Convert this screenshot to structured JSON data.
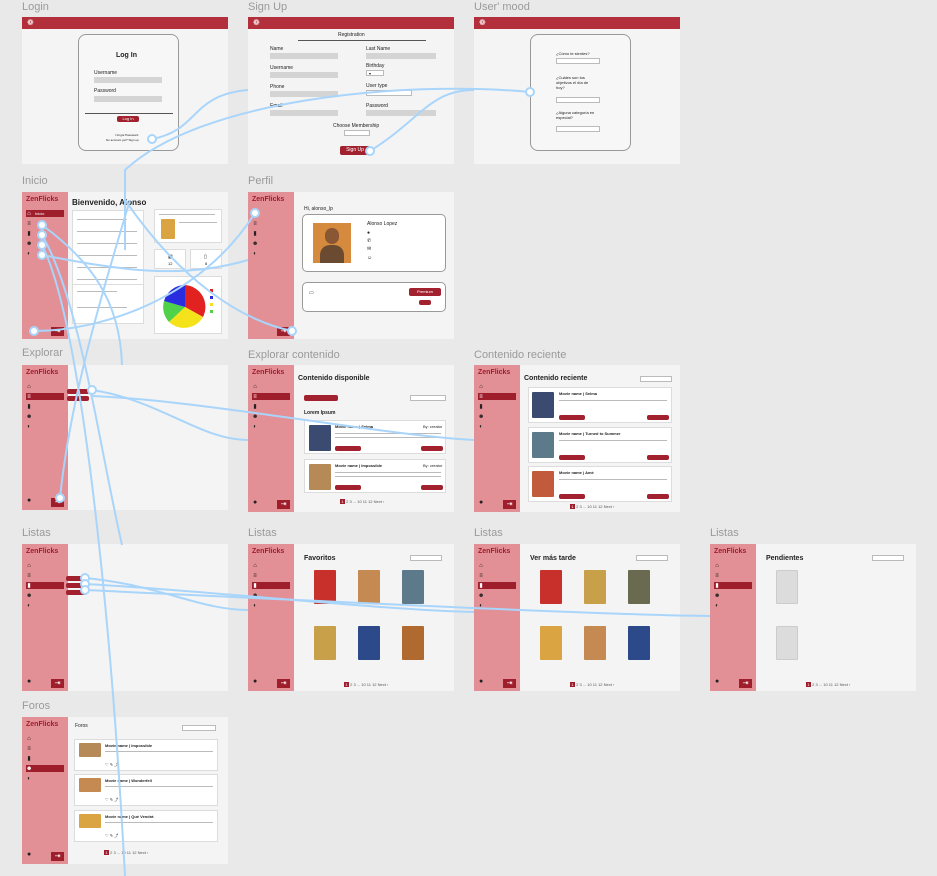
{
  "colors": {
    "accent": "#a1212f",
    "sidebar": "#e38f96",
    "topbar": "#b32f3b",
    "wire": "#a9d5fb"
  },
  "frames": {
    "login": "Login",
    "signup": "Sign Up",
    "mood": "User' mood",
    "inicio": "Inicio",
    "perfil": "Perfil",
    "explorar": "Explorar",
    "explorar_contenido": "Explorar contenido",
    "contenido_reciente": "Contenido reciente",
    "listas1": "Listas",
    "listas2": "Listas",
    "listas3": "Listas",
    "listas4": "Listas",
    "foros": "Foros"
  },
  "brand": "ZenFlicks",
  "login": {
    "title": "Log In",
    "username": "Username",
    "password": "Password",
    "button": "Log In",
    "forgot": "I forgot Password",
    "signup": "No account yet? Sign up"
  },
  "signup": {
    "heading": "Registration",
    "name": "Name",
    "last_name": "Last Name",
    "username": "Username",
    "birthday": "Birthday",
    "phone": "Phone",
    "user_type": "User type",
    "email": "Email",
    "password": "Password",
    "membership": "Choose Membership",
    "button": "Sign Up"
  },
  "mood": {
    "q1": "¿Cómo te sientes?",
    "q2": "¿Cuáles son tus objetivos el día de hoy?",
    "q3": "¿Alguna categoría en especial?"
  },
  "inicio": {
    "title": "Bienvenido, Alonso",
    "stat1": "12",
    "stat2": "8"
  },
  "perfil": {
    "greeting": "Hi, alonso_lp",
    "name": "Alonso Lopez",
    "button": "Premium"
  },
  "explorar_contenido": {
    "title": "Contenido disponible",
    "subtitle": "Lorem Ipsum",
    "movie1": "Movie name | Selma",
    "movie2": "Movie name | Impossible",
    "by": "By: creator"
  },
  "contenido_reciente": {
    "title": "Contenido reciente",
    "movie1": "Movie name | Selma",
    "movie2": "Movie name | Turned to Summer",
    "movie3": "Movie name | Amé"
  },
  "favoritos": {
    "title": "Favoritos"
  },
  "ver_mas_tarde": {
    "title": "Ver más tarde"
  },
  "pendientes": {
    "title": "Pendientes"
  },
  "foros": {
    "title": "Foros",
    "thread1": "Movie name | Impossible",
    "thread2": "Movie name | Wonderfell",
    "thread3": "Movie name | Qué Vendrá"
  },
  "sidebar": {
    "items": [
      "Inicio",
      "Explorar",
      "Listas",
      "Foros",
      "Perfil"
    ]
  },
  "pager": {
    "active": "1",
    "pages": "2  3  ...  10  11  12  Next ›",
    "prev": "‹ Previous"
  }
}
